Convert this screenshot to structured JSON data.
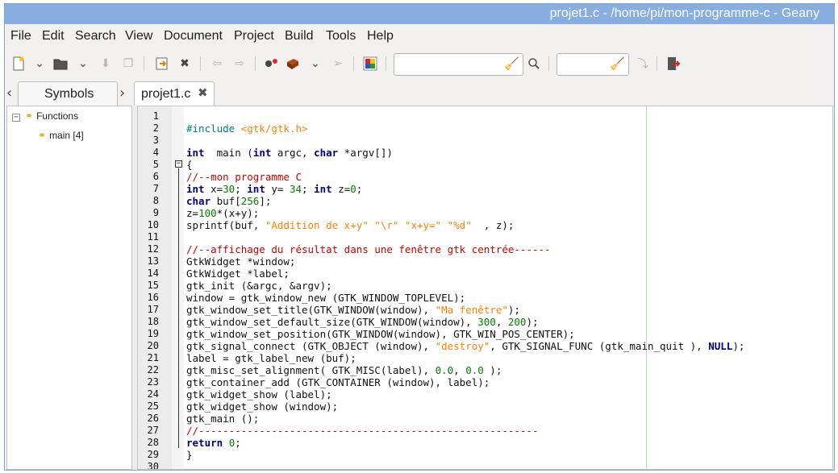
{
  "window": {
    "title": "projet1.c - /home/pi/mon-programme-c - Geany"
  },
  "menu": [
    "File",
    "Edit",
    "Search",
    "View",
    "Document",
    "Project",
    "Build",
    "Tools",
    "Help"
  ],
  "toolbar": {
    "search_value": "",
    "goto_value": "",
    "icons": [
      "new-file-icon",
      "dropdown-arrow-icon",
      "open-file-icon",
      "dropdown-arrow-icon",
      "save-icon",
      "save-all-icon",
      "revert-icon",
      "close-icon",
      "back-icon",
      "forward-icon",
      "compile-icon",
      "build-icon",
      "dropdown-arrow-icon",
      "run-icon",
      "color-chooser-icon",
      "broom-icon",
      "find-icon",
      "broom-icon",
      "jump-to-line-icon",
      "quit-icon"
    ]
  },
  "sidebar": {
    "tab_label": "Symbols",
    "group_label": "Functions",
    "items": [
      {
        "label": "main [4]"
      }
    ]
  },
  "editor": {
    "tab_label": "projet1.c",
    "line_numbers": [
      "1",
      "2",
      "3",
      "4",
      "5",
      "6",
      "7",
      "8",
      "9",
      "10",
      "11",
      "12",
      "13",
      "14",
      "15",
      "16",
      "17",
      "18",
      "19",
      "20",
      "21",
      "22",
      "23",
      "24",
      "25",
      "26",
      "27",
      "28",
      "29",
      "30"
    ],
    "lines": [
      [],
      [
        [
          "pp",
          "#include "
        ],
        [
          "str",
          "<gtk/gtk.h>"
        ]
      ],
      [],
      [
        [
          "kw",
          "int"
        ],
        [
          "",
          "  main ("
        ],
        [
          "kw",
          "int"
        ],
        [
          "",
          " argc, "
        ],
        [
          "kw",
          "char"
        ],
        [
          "",
          " *argv[])"
        ]
      ],
      [
        [
          "",
          "{"
        ]
      ],
      [
        [
          "cm",
          "//--mon programme C"
        ]
      ],
      [
        [
          "kw",
          "int"
        ],
        [
          "",
          " x="
        ],
        [
          "num",
          "30"
        ],
        [
          "",
          "; "
        ],
        [
          "kw",
          "int"
        ],
        [
          "",
          " y= "
        ],
        [
          "num",
          "34"
        ],
        [
          "",
          "; "
        ],
        [
          "kw",
          "int"
        ],
        [
          "",
          " z="
        ],
        [
          "num",
          "0"
        ],
        [
          "",
          ";"
        ]
      ],
      [
        [
          "kw",
          "char"
        ],
        [
          "",
          " buf["
        ],
        [
          "num",
          "256"
        ],
        [
          "",
          "];"
        ]
      ],
      [
        [
          "",
          "z="
        ],
        [
          "num",
          "100"
        ],
        [
          "",
          "*(x+y);"
        ]
      ],
      [
        [
          "",
          "sprintf(buf, "
        ],
        [
          "str",
          "\"Addition de x+y\" \"\\r\" \"x+y=\" \"%d\""
        ],
        [
          "",
          "  , z);"
        ]
      ],
      [],
      [
        [
          "cm",
          "//--affichage du résultat dans une fenêtre gtk centrée------"
        ]
      ],
      [
        [
          "",
          "GtkWidget *window;"
        ]
      ],
      [
        [
          "",
          "GtkWidget *label;"
        ]
      ],
      [
        [
          "",
          "gtk_init (&argc, &argv);"
        ]
      ],
      [
        [
          "",
          "window = gtk_window_new (GTK_WINDOW_TOPLEVEL);"
        ]
      ],
      [
        [
          "",
          "gtk_window_set_title(GTK_WINDOW(window), "
        ],
        [
          "str",
          "\"Ma fenêtre\""
        ],
        [
          "",
          ");"
        ]
      ],
      [
        [
          "",
          "gtk_window_set_default_size(GTK_WINDOW(window), "
        ],
        [
          "num",
          "300"
        ],
        [
          "",
          ", "
        ],
        [
          "num",
          "200"
        ],
        [
          "",
          ");"
        ]
      ],
      [
        [
          "",
          "gtk_window_set_position(GTK_WINDOW(window), GTK_WIN_POS_CENTER);"
        ]
      ],
      [
        [
          "",
          "gtk_signal_connect (GTK_OBJECT (window), "
        ],
        [
          "str",
          "\"destroy\""
        ],
        [
          "",
          ", GTK_SIGNAL_FUNC (gtk_main_quit ), "
        ],
        [
          "kw",
          "NULL"
        ],
        [
          "",
          ");"
        ]
      ],
      [
        [
          "",
          "label = gtk_label_new (buf);"
        ]
      ],
      [
        [
          "",
          "gtk_misc_set_alignment( GTK_MISC(label), "
        ],
        [
          "num",
          "0.0"
        ],
        [
          "",
          ", "
        ],
        [
          "num",
          "0.0"
        ],
        [
          "",
          " );"
        ]
      ],
      [
        [
          "",
          "gtk_container_add (GTK_CONTAINER (window), label);"
        ]
      ],
      [
        [
          "",
          "gtk_widget_show (label);"
        ]
      ],
      [
        [
          "",
          "gtk_widget_show (window);"
        ]
      ],
      [
        [
          "",
          "gtk_main ();"
        ]
      ],
      [
        [
          "cm",
          "//--------------------------------------------------------"
        ]
      ],
      [
        [
          "kw",
          "return"
        ],
        [
          "",
          " "
        ],
        [
          "num",
          "0"
        ],
        [
          "",
          ";"
        ]
      ],
      [
        [
          "",
          "}"
        ]
      ],
      []
    ]
  }
}
